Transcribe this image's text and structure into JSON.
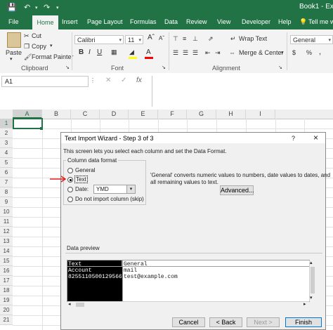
{
  "window": {
    "title": "Book1 - Exc"
  },
  "tabs": [
    "File",
    "Home",
    "Insert",
    "Page Layout",
    "Formulas",
    "Data",
    "Review",
    "View",
    "Developer",
    "Help"
  ],
  "tell_me": "Tell me w",
  "clipboard": {
    "paste": "Paste",
    "cut": "Cut",
    "copy": "Copy",
    "format_painter": "Format Painter",
    "label": "Clipboard"
  },
  "font": {
    "name": "Calibri",
    "size": "11",
    "label": "Font"
  },
  "alignment": {
    "wrap_text": "Wrap Text",
    "merge_center": "Merge & Center",
    "label": "Alignment"
  },
  "number": {
    "format": "General",
    "currency": "$",
    "percent": "%",
    "comma": ","
  },
  "formula_bar": {
    "name_box": "A1",
    "fx": "fx"
  },
  "columns": [
    "A",
    "B",
    "C",
    "D",
    "E",
    "F",
    "G",
    "H",
    "I"
  ],
  "rows": [
    "1",
    "2",
    "3",
    "4",
    "5",
    "6",
    "7",
    "8",
    "9",
    "10",
    "11",
    "12",
    "13",
    "14",
    "15",
    "16",
    "17",
    "18",
    "19",
    "20",
    "21"
  ],
  "dialog": {
    "title": "Text Import Wizard - Step 3 of 3",
    "help": "?",
    "close": "×",
    "intro": "This screen lets you select each column and set the Data Format.",
    "column_format_label": "Column data format",
    "options": {
      "general": "General",
      "text": "Text",
      "date": "Date:",
      "date_value": "YMD",
      "skip": "Do not import column (skip)"
    },
    "selected": "text",
    "description_line1": "'General' converts numeric values to numbers, date values to dates, and",
    "description_line2": "all remaining values to text.",
    "advanced": "Advanced...",
    "preview_label": "Data preview",
    "preview_headers": [
      "Text",
      "General"
    ],
    "preview_rows": [
      [
        "Account",
        "mail"
      ],
      [
        "8255110500129566",
        "test@example.com"
      ]
    ],
    "buttons": {
      "cancel": "Cancel",
      "back": "< Back",
      "next": "Next >",
      "finish": "Finish"
    }
  },
  "colors": {
    "excel_green": "#217346",
    "annotation_arrow": "#e02020",
    "selected_column": "#000000"
  }
}
